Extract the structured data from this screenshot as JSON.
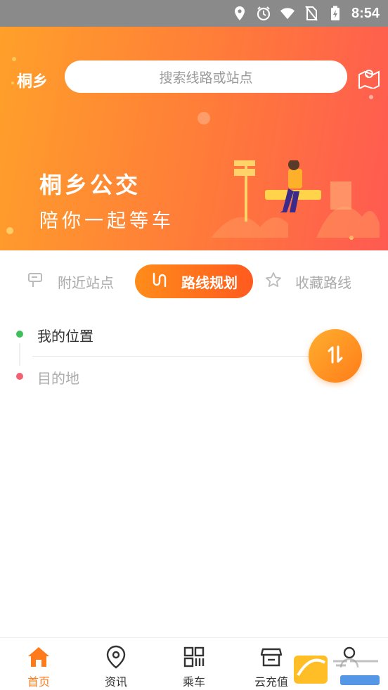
{
  "status_bar": {
    "time": "8:54"
  },
  "header": {
    "city": "桐乡",
    "search_placeholder": "搜索线路或站点"
  },
  "banner": {
    "title": "桐乡公交",
    "subtitle": "陪你一起等车"
  },
  "tabs": [
    {
      "label": "附近站点",
      "active": false
    },
    {
      "label": "路线规划",
      "active": true
    },
    {
      "label": "收藏路线",
      "active": false
    }
  ],
  "route": {
    "from": "我的位置",
    "to_placeholder": "目的地"
  },
  "bottom_nav": [
    {
      "label": "首页",
      "active": true
    },
    {
      "label": "资讯",
      "active": false
    },
    {
      "label": "乘车",
      "active": false
    },
    {
      "label": "云充值",
      "active": false
    },
    {
      "label": "",
      "active": false
    }
  ],
  "colors": {
    "accent": "#ff7a1a",
    "banner_start": "#ffa02a",
    "banner_end": "#ff5a52"
  }
}
